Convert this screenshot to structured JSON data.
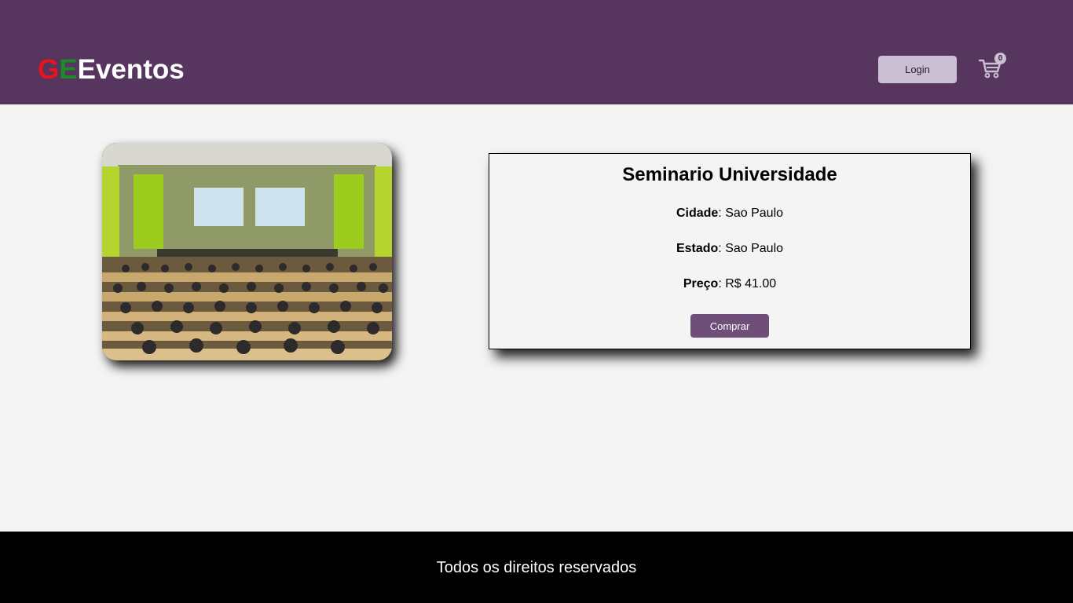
{
  "header": {
    "logo": {
      "part1": "G",
      "part2": "E",
      "part3": "Eventos"
    },
    "login_label": "Login",
    "cart_count": "0",
    "cart_icon": "shopping-cart-icon"
  },
  "event": {
    "image_alt": "auditorium-photo",
    "title": "Seminario Universidade",
    "city_label": "Cidade",
    "city_value": ": Sao Paulo",
    "state_label": "Estado",
    "state_value": ": Sao Paulo",
    "price_label": "Preço",
    "price_value": ": R$ 41.00",
    "buy_label": "Comprar"
  },
  "footer": {
    "text": "Todos os direitos reservados"
  },
  "colors": {
    "header_bg": "#56355f",
    "logo_g": "#e8141b",
    "logo_e": "#1e8a2a",
    "login_bg": "#cbbfd3",
    "buy_bg": "#6f4e79",
    "page_bg": "#f4f4f4",
    "footer_bg": "#000000"
  }
}
